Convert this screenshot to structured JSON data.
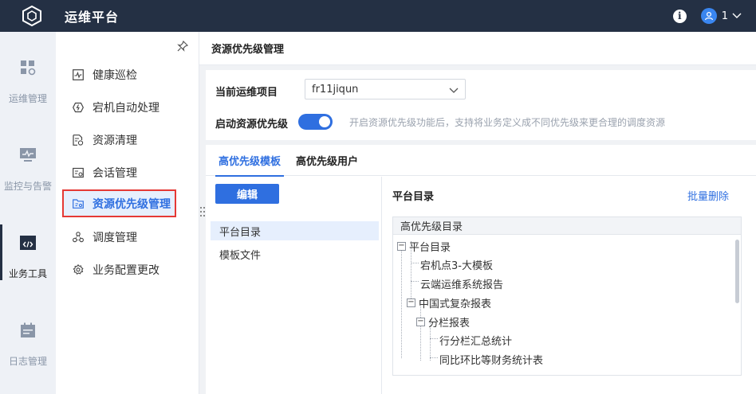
{
  "app": {
    "title": "运维平台",
    "user_name": "1"
  },
  "rail": {
    "items": [
      {
        "label": "运维管理",
        "icon": "grid-apps-icon"
      },
      {
        "label": "监控与告警",
        "icon": "monitor-icon"
      },
      {
        "label": "业务工具",
        "icon": "code-window-icon",
        "active": true
      },
      {
        "label": "日志管理",
        "icon": "calendar-log-icon"
      }
    ]
  },
  "submenu": {
    "items": [
      {
        "label": "健康巡检",
        "icon": "health-chart-icon"
      },
      {
        "label": "宕机自动处理",
        "icon": "auto-handle-icon"
      },
      {
        "label": "资源清理",
        "icon": "clean-doc-icon"
      },
      {
        "label": "会话管理",
        "icon": "session-icon"
      },
      {
        "label": "资源优先级管理",
        "icon": "priority-folder-icon",
        "active": true
      },
      {
        "label": "调度管理",
        "icon": "schedule-nodes-icon"
      },
      {
        "label": "业务配置更改",
        "icon": "config-gear-icon"
      }
    ]
  },
  "page": {
    "title": "资源优先级管理",
    "project_label": "当前运维项目",
    "project_value": "fr11jiqun",
    "priority_label": "启动资源优先级",
    "priority_enabled": true,
    "priority_hint": "开启资源优先级功能后，支持将业务定义成不同优先级来更合理的调度资源"
  },
  "tabs": [
    {
      "label": "高优先级模板",
      "active": true
    },
    {
      "label": "高优先级用户",
      "active": false
    }
  ],
  "left_pane": {
    "edit_label": "编辑",
    "items": [
      {
        "label": "平台目录",
        "active": true
      },
      {
        "label": "模板文件",
        "active": false
      }
    ]
  },
  "right_pane": {
    "title": "平台目录",
    "bulk_delete_label": "批量删除",
    "tree_header": "高优先级目录",
    "tree": [
      {
        "label": "平台目录",
        "toggle": "−"
      },
      {
        "label": "宕机点3-大模板"
      },
      {
        "label": "云端运维系统报告"
      },
      {
        "label": "中国式复杂报表",
        "toggle": "−"
      },
      {
        "label": "分栏报表",
        "toggle": "−"
      },
      {
        "label": "行分栏汇总统计"
      },
      {
        "label": "同比环比等财务统计表"
      }
    ]
  },
  "colors": {
    "topbar": "#243044",
    "accent": "#2f6fe0",
    "highlight_border": "#e53935"
  }
}
